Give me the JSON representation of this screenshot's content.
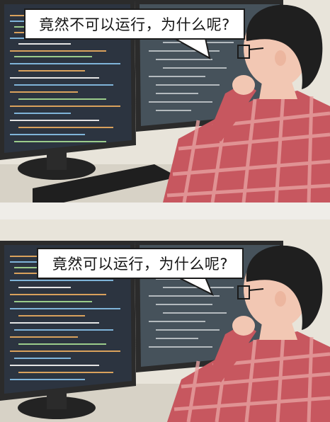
{
  "panels": [
    {
      "bubble_text": "竟然不可以运行，为什么呢?"
    },
    {
      "bubble_text": "竟然可以运行，为什么呢?"
    }
  ],
  "colors": {
    "monitor_bezel": "#2b2b2b",
    "screen_left": "#2c3440",
    "screen_right": "#46525b",
    "code_orange": "#d9a15c",
    "code_blue": "#7fb4d9",
    "code_green": "#9bcc8b",
    "shirt_red": "#c7575f",
    "shirt_check": "#e7a1a1",
    "hair": "#1f1f1f",
    "skin": "#f2c7b3",
    "background": "#e8e4da"
  },
  "icons": [
    "speech-bubble-icon"
  ]
}
